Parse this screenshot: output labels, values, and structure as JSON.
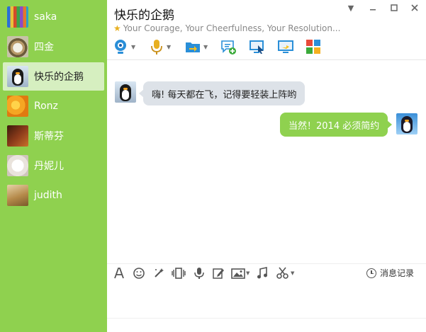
{
  "contacts": [
    {
      "name": "saka",
      "avatar": "pencils-avatar"
    },
    {
      "name": "四金",
      "avatar": "coffee-avatar"
    },
    {
      "name": "快乐的企鹅",
      "avatar": "penguin-avatar",
      "active": true
    },
    {
      "name": "Ronz",
      "avatar": "orange-flower-avatar"
    },
    {
      "name": "斯蒂芬",
      "avatar": "violin-avatar"
    },
    {
      "name": "丹妮儿",
      "avatar": "white-cat-avatar"
    },
    {
      "name": "judith",
      "avatar": "tea-avatar"
    }
  ],
  "chat": {
    "title": "快乐的企鹅",
    "status": "Your Courage, Your Cheerfulness, Your Resolution...",
    "messages": [
      {
        "direction": "in",
        "text": "嗨! 每天都在飞，记得要轻装上阵哟"
      },
      {
        "direction": "out",
        "text": "当然！2014 必须简约"
      }
    ]
  },
  "input_toolbar": {
    "history_label": "消息记录"
  },
  "colors": {
    "sidebar": "#8fd14f",
    "active_contact": "#d6efc0",
    "incoming_bubble": "#dde2e8",
    "outgoing_bubble": "#8fd14f"
  }
}
